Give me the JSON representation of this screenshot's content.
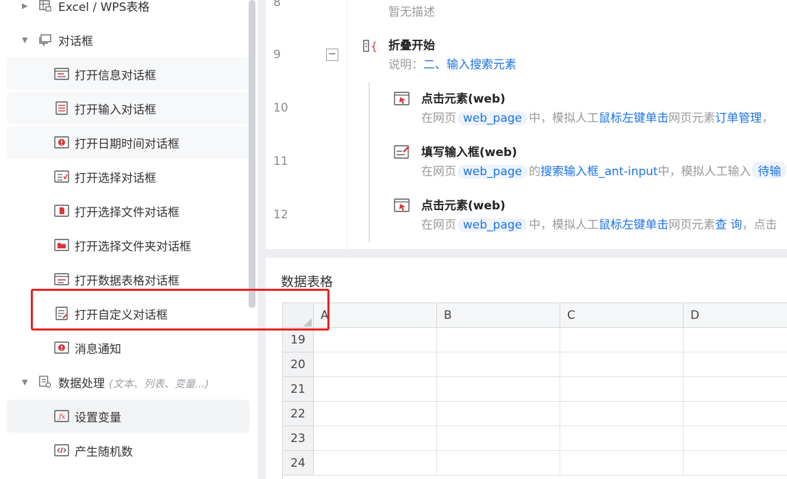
{
  "sidebar": {
    "items": [
      {
        "label": "Excel / WPS表格",
        "icon": "excel-icon",
        "expanded": false
      },
      {
        "label": "对话框",
        "icon": "dialog-icon",
        "expanded": true
      },
      {
        "label": "打开信息对话框",
        "icon": "info-dialog-icon"
      },
      {
        "label": "打开输入对话框",
        "icon": "input-dialog-icon"
      },
      {
        "label": "打开日期时间对话框",
        "icon": "datetime-dialog-icon"
      },
      {
        "label": "打开选择对话框",
        "icon": "select-dialog-icon"
      },
      {
        "label": "打开选择文件对话框",
        "icon": "file-dialog-icon"
      },
      {
        "label": "打开选择文件夹对话框",
        "icon": "folder-dialog-icon"
      },
      {
        "label": "打开数据表格对话框",
        "icon": "table-dialog-icon"
      },
      {
        "label": "打开自定义对话框",
        "icon": "custom-dialog-icon"
      },
      {
        "label": "消息通知",
        "icon": "notify-icon"
      },
      {
        "label": "数据处理",
        "hint": "(文本、列表、变量...)",
        "icon": "data-process-icon",
        "expanded": true
      },
      {
        "label": "设置变量",
        "icon": "set-variable-icon"
      },
      {
        "label": "产生随机数",
        "icon": "random-icon"
      }
    ]
  },
  "flow": {
    "line_numbers": [
      "8",
      "9",
      "10",
      "11",
      "12"
    ],
    "step8": {
      "desc": "暂无描述"
    },
    "fold": {
      "title": "折叠开始",
      "desc_prefix": "说明：",
      "desc_value": "二、输入搜索元素",
      "fold_symbol": "−"
    },
    "step10": {
      "title": "点击元素(web)",
      "desc_a": "在网页",
      "tag": "web_page",
      "desc_b": "中，模拟人工",
      "link1": "鼠标左键单击",
      "desc_c": "网页元素",
      "link2": "订单管理",
      "desc_d": "，"
    },
    "step11": {
      "title": "填写输入框(web)",
      "desc_a": "在网页",
      "tag": "web_page",
      "desc_b": "的",
      "link1": "搜索输入框_ant-input",
      "desc_c": "中，模拟人工输入",
      "tag2": "待输"
    },
    "step12": {
      "title": "点击元素(web)",
      "desc_a": "在网页",
      "tag": "web_page",
      "desc_b": "中，模拟人工",
      "link1": "鼠标左键单击",
      "desc_c": "网页元素",
      "link2": "查 询",
      "desc_d": "，点击"
    }
  },
  "datatable": {
    "title": "数据表格",
    "columns": [
      "A",
      "B",
      "C",
      "D"
    ],
    "rows": [
      "19",
      "20",
      "21",
      "22",
      "23",
      "24"
    ]
  },
  "colors": {
    "accent": "#1a73e8",
    "highlight": "#e8201f",
    "icon_red": "#d9363e"
  }
}
